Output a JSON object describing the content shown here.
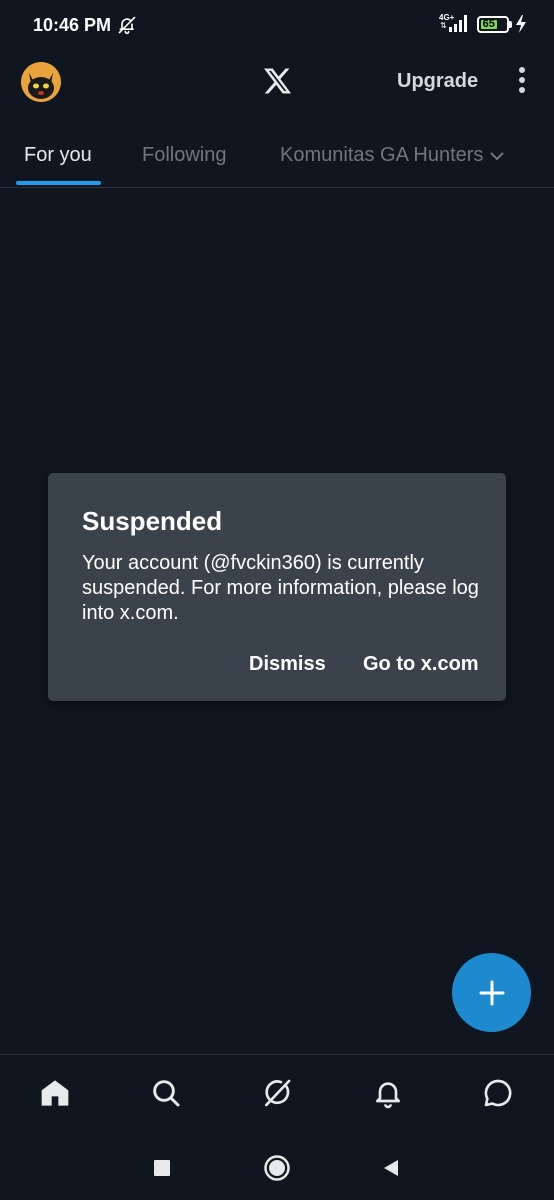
{
  "status_bar": {
    "time": "10:46 PM",
    "network": "4G+",
    "battery": "65",
    "icons": [
      "bell-off-icon",
      "signal-icon",
      "battery-icon",
      "charging-icon"
    ]
  },
  "header": {
    "upgrade_label": "Upgrade",
    "logo": "x-logo-icon",
    "menu": "more-vertical-icon"
  },
  "tabs": [
    {
      "label": "For you",
      "active": true
    },
    {
      "label": "Following",
      "active": false
    },
    {
      "label": "Komunitas GA Hunters",
      "active": false
    }
  ],
  "dialog": {
    "title": "Suspended",
    "body": "Your account (@fvckin360) is currently suspended. For more information, please log into x.com.",
    "dismiss_label": "Dismiss",
    "goto_label": "Go to x.com"
  },
  "fab": {
    "icon": "plus-icon"
  },
  "bottom_nav": [
    "home-icon",
    "search-icon",
    "grok-icon",
    "notifications-icon",
    "messages-icon"
  ],
  "system_nav": [
    "recents-icon",
    "home-circle-icon",
    "back-icon"
  ],
  "colors": {
    "background": "#0f1620",
    "accent": "#1d9bf0",
    "dialog": "#3a434b",
    "muted_text": "#71767b"
  }
}
